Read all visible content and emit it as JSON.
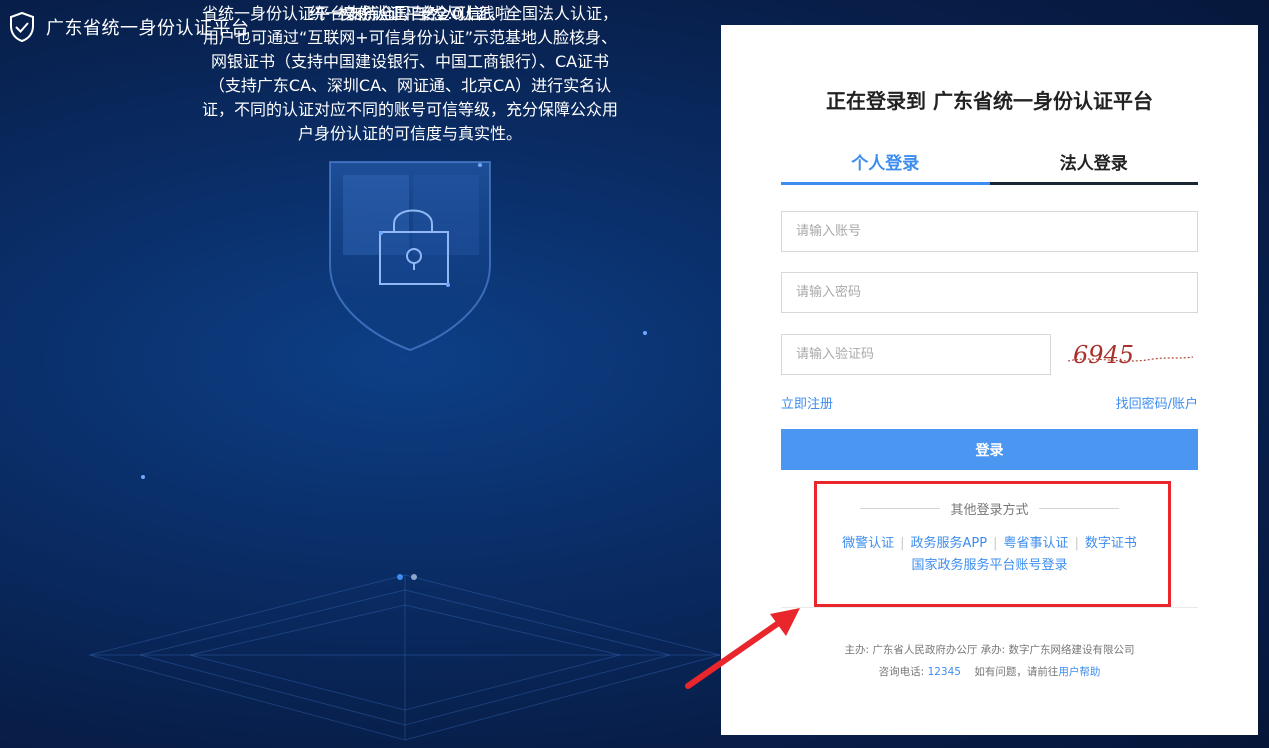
{
  "header": {
    "title": "广东省统一身份认证平台"
  },
  "promo": {
    "subtitle": "统一身份认证平台2.0上线啦",
    "headline": "权威认证，安全可信",
    "description": "省统一身份认证平台支持全国自然人认证、全国法人认证，用户也可通过“互联网+可信身份认证”示范基地人脸核身、网银证书（支持中国建设银行、中国工商银行）、CA证书（支持广东CA、深圳CA、网证通、北京CA）进行实名认证，不同的认证对应不同的账号可信等级，充分保障公众用户身份认证的可信度与真实性。"
  },
  "login": {
    "title": "正在登录到 广东省统一身份认证平台",
    "tabs": [
      {
        "label": "个人登录",
        "active": true
      },
      {
        "label": "法人登录",
        "active": false
      }
    ],
    "account_placeholder": "请输入账号",
    "password_placeholder": "请输入密码",
    "captcha_placeholder": "请输入验证码",
    "captcha_text": "6945",
    "register_link": "立即注册",
    "forgot_link": "找回密码/账户",
    "login_button": "登录",
    "other_title": "其他登录方式",
    "other_methods": [
      "微警认证",
      "政务服务APP",
      "粤省事认证",
      "数字证书"
    ],
    "other_method_full": "国家政务服务平台账号登录",
    "footer_line1": "主办: 广东省人民政府办公厅   承办: 数字广东网络建设有限公司",
    "footer_phone_label": "咨询电话:",
    "footer_phone": "12345",
    "footer_help_prefix": "如有问题，请前往",
    "footer_help_link": "用户帮助"
  },
  "colors": {
    "accent": "#3d8df0",
    "annotation": "#e8262b",
    "background": "#0a2e68"
  }
}
